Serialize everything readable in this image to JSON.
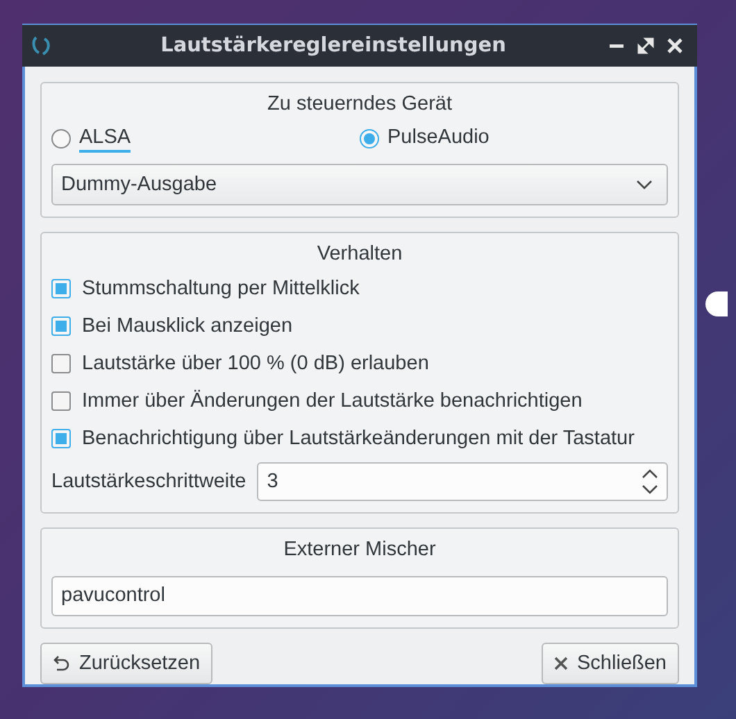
{
  "window": {
    "title": "Lautstärkereglereinstellungen"
  },
  "device_group": {
    "title": "Zu steuerndes Gerät",
    "options": [
      {
        "label": "ALSA",
        "selected": false,
        "focused": true
      },
      {
        "label": "PulseAudio",
        "selected": true,
        "focused": false
      }
    ],
    "dropdown": {
      "value": "Dummy-Ausgabe"
    }
  },
  "behavior_group": {
    "title": "Verhalten",
    "checkboxes": [
      {
        "label": "Stummschaltung per Mittelklick",
        "checked": true
      },
      {
        "label": "Bei Mausklick anzeigen",
        "checked": true
      },
      {
        "label": "Lautstärke über 100 % (0 dB) erlauben",
        "checked": false
      },
      {
        "label": "Immer über Änderungen der Lautstärke benachrichtigen",
        "checked": false
      },
      {
        "label": "Benachrichtigung über Lautstärkeänderungen mit der Tastatur",
        "checked": true
      }
    ],
    "step": {
      "label": "Lautstärkeschrittweite",
      "value": "3"
    }
  },
  "mixer_group": {
    "title": "Externer Mischer",
    "field": {
      "value": "pavucontrol"
    }
  },
  "buttons": [
    {
      "label": "Zurücksetzen",
      "kind": "reset"
    },
    {
      "label": "Schließen",
      "kind": "close"
    }
  ]
}
